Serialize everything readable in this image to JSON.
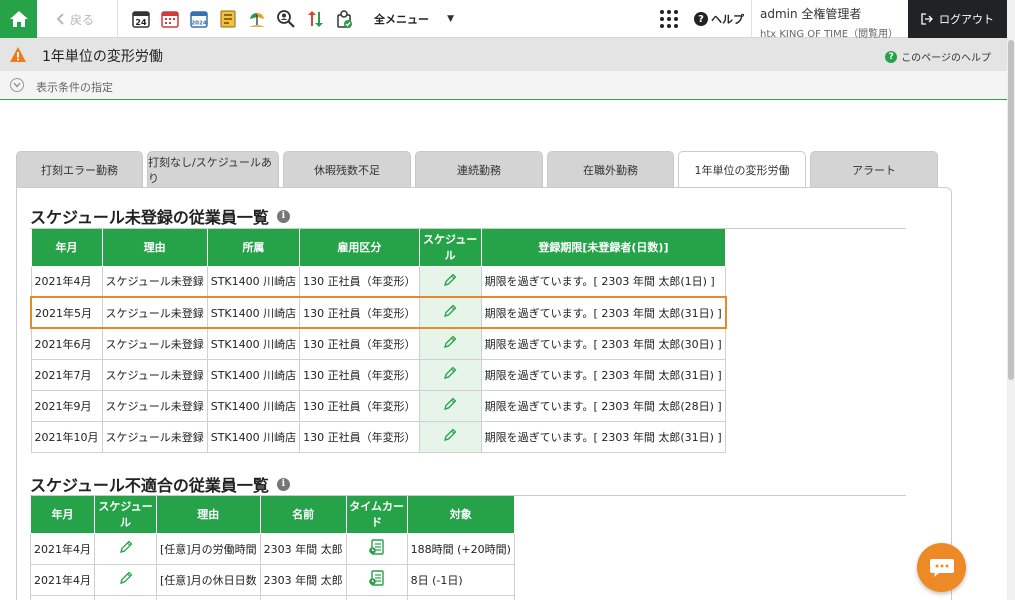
{
  "topbar": {
    "back_label": "戻る",
    "all_menu_label": "全メニュー",
    "help_label": "ヘルプ",
    "user_name": "admin 全権管理者",
    "user_company": "htx KING OF TIME（閲覧用）",
    "logout_label": "ログアウト",
    "calendar_day_badge": "24",
    "calendar_year_badge": "2024"
  },
  "page": {
    "title": "1年単位の変形労働",
    "help_label": "このページのヘルプ",
    "condition_label": "表示条件の指定"
  },
  "tabs": [
    {
      "label": "打刻エラー勤務"
    },
    {
      "label": "打刻なし/スケジュールあり"
    },
    {
      "label": "休暇残数不足"
    },
    {
      "label": "連続勤務"
    },
    {
      "label": "在職外勤務"
    },
    {
      "label": "1年単位の変形労働"
    },
    {
      "label": "アラート"
    }
  ],
  "section1": {
    "title": "スケジュール未登録の従業員一覧",
    "headers": [
      "年月",
      "理由",
      "所属",
      "雇用区分",
      "スケジュール",
      "登録期限[未登録者(日数)]"
    ],
    "rows": [
      {
        "month": "2021年4月",
        "reason": "スケジュール未登録",
        "dept": "STK1400 川崎店",
        "type": "130 正社員（年変形）",
        "deadline": "期限を過ぎています。[ 2303 年間 太郎(1日) ]"
      },
      {
        "month": "2021年5月",
        "reason": "スケジュール未登録",
        "dept": "STK1400 川崎店",
        "type": "130 正社員（年変形）",
        "deadline": "期限を過ぎています。[ 2303 年間 太郎(31日) ]"
      },
      {
        "month": "2021年6月",
        "reason": "スケジュール未登録",
        "dept": "STK1400 川崎店",
        "type": "130 正社員（年変形）",
        "deadline": "期限を過ぎています。[ 2303 年間 太郎(30日) ]"
      },
      {
        "month": "2021年7月",
        "reason": "スケジュール未登録",
        "dept": "STK1400 川崎店",
        "type": "130 正社員（年変形）",
        "deadline": "期限を過ぎています。[ 2303 年間 太郎(31日) ]"
      },
      {
        "month": "2021年9月",
        "reason": "スケジュール未登録",
        "dept": "STK1400 川崎店",
        "type": "130 正社員（年変形）",
        "deadline": "期限を過ぎています。[ 2303 年間 太郎(28日) ]"
      },
      {
        "month": "2021年10月",
        "reason": "スケジュール未登録",
        "dept": "STK1400 川崎店",
        "type": "130 正社員（年変形）",
        "deadline": "期限を過ぎています。[ 2303 年間 太郎(31日) ]"
      }
    ]
  },
  "section2": {
    "title": "スケジュール不適合の従業員一覧",
    "headers": [
      "年月",
      "スケジュール",
      "理由",
      "名前",
      "タイムカード",
      "対象"
    ],
    "rows": [
      {
        "month": "2021年4月",
        "reason": "[任意]月の労働時間",
        "name": "2303 年間 太郎",
        "target": "188時間 (+20時間)"
      },
      {
        "month": "2021年4月",
        "reason": "[任意]月の休日日数",
        "name": "2303 年間 太郎",
        "target": "8日 (-1日)"
      }
    ]
  },
  "colors": {
    "brand_green": "#26a249",
    "highlight_orange": "#e48a2c",
    "chat_orange": "#ee8a25",
    "logout_bg": "#1f2326"
  }
}
